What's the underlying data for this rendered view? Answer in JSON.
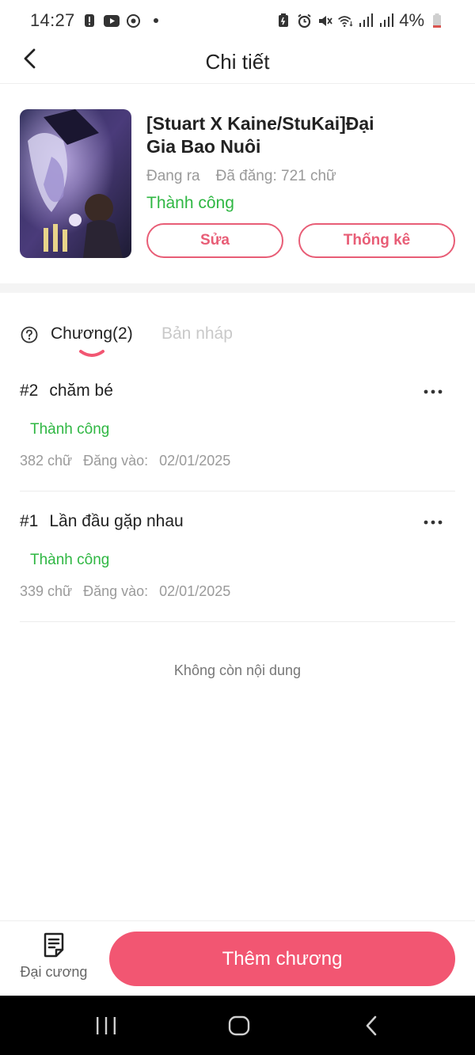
{
  "status_bar": {
    "time": "14:27",
    "battery": "4%"
  },
  "header": {
    "title": "Chi tiết"
  },
  "book": {
    "title": "[Stuart X Kaine/StuKai]Đại Gia Bao Nuôi",
    "state": "Đang ra",
    "word_count": "Đã đăng: 721 chữ",
    "review_status": "Thành công",
    "edit_label": "Sửa",
    "stats_label": "Thống kê"
  },
  "tabs": {
    "chapters_label": "Chương(2)",
    "drafts_label": "Bản nháp"
  },
  "chapters": [
    {
      "number": "#2",
      "title": "chăm bé",
      "status": "Thành công",
      "words": "382 chữ",
      "date_label": "Đăng vào:",
      "date": "02/01/2025"
    },
    {
      "number": "#1",
      "title": "Lần đầu gặp nhau",
      "status": "Thành công",
      "words": "339 chữ",
      "date_label": "Đăng vào:",
      "date": "02/01/2025"
    }
  ],
  "list_end_text": "Không còn nội dung",
  "bottom_bar": {
    "outline_label": "Đại cương",
    "add_chapter_label": "Thêm chương"
  },
  "colors": {
    "accent": "#f25672",
    "outline_accent": "#e85d76",
    "success": "#2fb743"
  },
  "icons": {
    "back": "chevron-left-icon",
    "more": "more-horizontal-icon",
    "help": "question-circle-icon",
    "outline": "document-lines-icon"
  }
}
